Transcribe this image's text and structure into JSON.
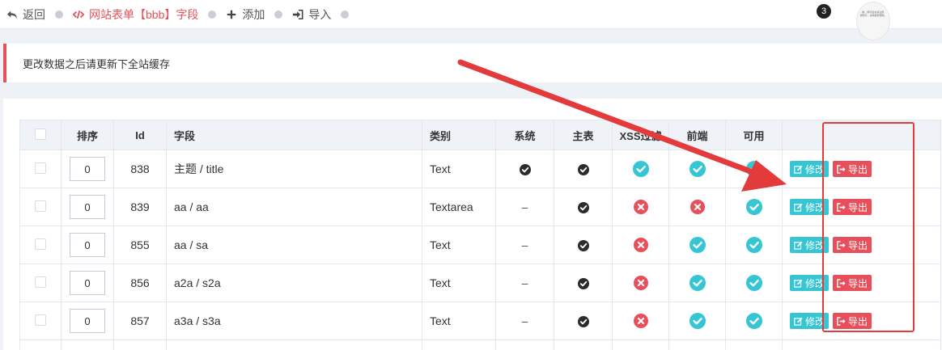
{
  "toolbar": {
    "back_label": "返回",
    "current_label": "网站表单【bbb】字段",
    "add_label": "添加",
    "import_label": "导入",
    "notification_count": "3",
    "avatar_text": "...像，即可加友请注意，通知与，请用搜索帮助。"
  },
  "notice": {
    "text": "更改数据之后请更新下全站缓存"
  },
  "table": {
    "columns": {
      "order": "排序",
      "id": "Id",
      "field": "字段",
      "type": "类别",
      "system": "系统",
      "main": "主表",
      "xss": "XSS过滤",
      "frontend": "前端",
      "enabled": "可用"
    },
    "actions": {
      "edit_label": "修改",
      "export_label": "导出"
    },
    "rows": [
      {
        "order": "0",
        "id": "838",
        "field": "主题 / title",
        "type": "Text",
        "system": "check-dark",
        "main": "check-dark",
        "xss": "check-teal",
        "frontend": "check-teal",
        "enabled": "check-teal"
      },
      {
        "order": "0",
        "id": "839",
        "field": "aa / aa",
        "type": "Textarea",
        "system": "dash",
        "main": "check-dark",
        "xss": "cross-red",
        "frontend": "cross-red",
        "enabled": "check-teal"
      },
      {
        "order": "0",
        "id": "855",
        "field": "aa / sa",
        "type": "Text",
        "system": "dash",
        "main": "check-dark",
        "xss": "cross-red",
        "frontend": "check-teal",
        "enabled": "check-teal"
      },
      {
        "order": "0",
        "id": "856",
        "field": "a2a / s2a",
        "type": "Text",
        "system": "dash",
        "main": "check-dark",
        "xss": "cross-red",
        "frontend": "check-teal",
        "enabled": "check-teal"
      },
      {
        "order": "0",
        "id": "857",
        "field": "a3a / s3a",
        "type": "Text",
        "system": "dash",
        "main": "check-dark",
        "xss": "cross-red",
        "frontend": "check-teal",
        "enabled": "check-teal"
      }
    ]
  },
  "colors": {
    "accent_red": "#e7505a",
    "accent_teal": "#36c6d3",
    "header_bg": "#eff3f8",
    "annotation_red": "#e33b3b"
  }
}
